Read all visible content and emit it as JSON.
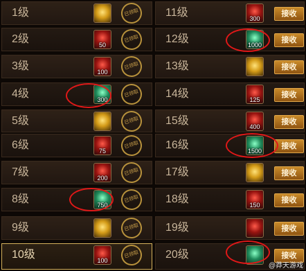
{
  "left_rows": [
    {
      "level": "1级",
      "reward_icon": "gold-coins-icon",
      "reward_qty": "",
      "status": "已领取"
    },
    {
      "level": "2级",
      "reward_icon": "ruby-chest-icon",
      "reward_qty": "50",
      "status": "已领取"
    },
    {
      "level": "3级",
      "reward_icon": "ruby-chest-icon",
      "reward_qty": "100",
      "status": "已领取"
    },
    {
      "level": "4级",
      "reward_icon": "gem-icon",
      "reward_qty": "300",
      "status": "已领取"
    },
    {
      "level": "5级",
      "reward_icon": "gold-coins-icon",
      "reward_qty": "",
      "status": "已领取"
    },
    {
      "level": "6级",
      "reward_icon": "ruby-chest-icon",
      "reward_qty": "75",
      "status": "已领取"
    },
    {
      "level": "7级",
      "reward_icon": "ruby-chest-icon",
      "reward_qty": "200",
      "status": "已领取"
    },
    {
      "level": "8级",
      "reward_icon": "gem-icon",
      "reward_qty": "750",
      "status": "已领取"
    },
    {
      "level": "9级",
      "reward_icon": "gold-coins-icon",
      "reward_qty": "",
      "status": "已领取"
    },
    {
      "level": "10级",
      "reward_icon": "ruby-chest-icon",
      "reward_qty": "100",
      "status": "已领取"
    }
  ],
  "right_rows": [
    {
      "level": "11级",
      "reward_icon": "ruby-chest-icon",
      "reward_qty": "300",
      "button": "接收"
    },
    {
      "level": "12级",
      "reward_icon": "gem-icon",
      "reward_qty": "1000",
      "button": "接收"
    },
    {
      "level": "13级",
      "reward_icon": "gold-coins-icon",
      "reward_qty": "",
      "button": "接收"
    },
    {
      "level": "14级",
      "reward_icon": "ruby-chest-icon",
      "reward_qty": "125",
      "button": "接收"
    },
    {
      "level": "15级",
      "reward_icon": "ruby-chest-icon",
      "reward_qty": "400",
      "button": "接收"
    },
    {
      "level": "16级",
      "reward_icon": "gem-icon",
      "reward_qty": "1500",
      "button": "接收"
    },
    {
      "level": "17级",
      "reward_icon": "gold-coins-icon",
      "reward_qty": "",
      "button": "接收"
    },
    {
      "level": "18级",
      "reward_icon": "ruby-chest-icon",
      "reward_qty": "150",
      "button": "接收"
    },
    {
      "level": "19级",
      "reward_icon": "ruby-chest-icon",
      "reward_qty": "",
      "button": "接收"
    },
    {
      "level": "20级",
      "reward_icon": "gem-icon",
      "reward_qty": "",
      "button": "接收"
    }
  ],
  "selected_level": "10级",
  "watermark": "@莽天游戏",
  "colors": {
    "highlight_circle": "#e01818",
    "claim_button": "#b8731f",
    "selected_border": "#d6b25c"
  }
}
